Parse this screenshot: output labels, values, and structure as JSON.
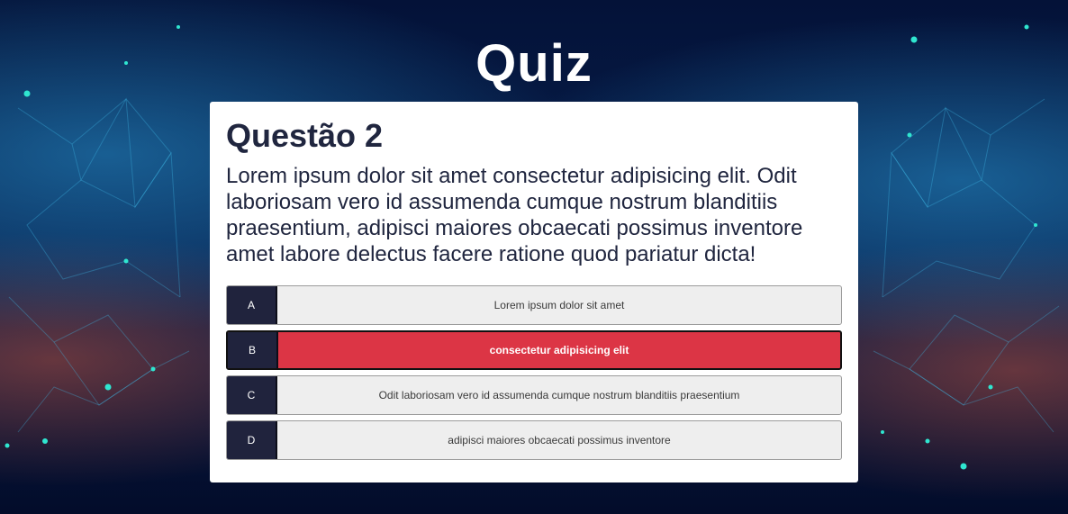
{
  "page": {
    "title": "Quiz"
  },
  "question": {
    "heading": "Questão 2",
    "text": "Lorem ipsum dolor sit amet consectetur adipisicing elit. Odit laboriosam vero id assumenda cumque nostrum blanditiis praesentium, adipisci maiores obcaecati possimus inventore amet labore delectus facere ratione quod pariatur dicta!"
  },
  "answers": [
    {
      "letter": "A",
      "text": "Lorem ipsum dolor sit amet",
      "selected": false
    },
    {
      "letter": "B",
      "text": "consectetur adipisicing elit",
      "selected": true
    },
    {
      "letter": "C",
      "text": "Odit laboriosam vero id assumenda cumque nostrum blanditiis praesentium",
      "selected": false
    },
    {
      "letter": "D",
      "text": "adipisci maiores obcaecati possimus inventore",
      "selected": false
    }
  ],
  "colors": {
    "selected_answer": "#dc3545",
    "letter_box": "#20233d",
    "answer_bg": "#eeeeee",
    "heading": "#20263f",
    "background": "#041238"
  },
  "icons": {
    "background": "network-particles-background"
  }
}
